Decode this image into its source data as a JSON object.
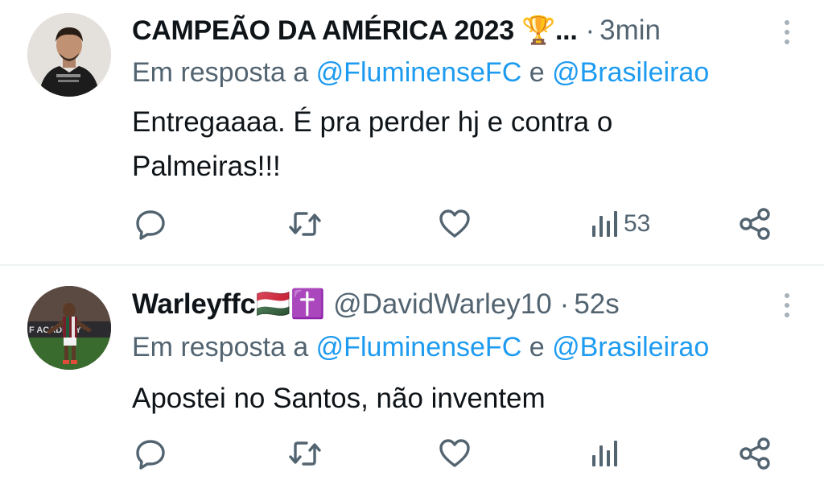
{
  "tweets": [
    {
      "display_name": "CAMPEÃO DA AMÉRICA 2023 🏆...",
      "handle": "",
      "separator": "·",
      "time": "3min",
      "reply_prefix": "Em resposta a",
      "mention_1": "@FluminenseFC",
      "reply_joiner": "e",
      "mention_2": "@Brasileirao",
      "text": "Entregaaaa. É pra perder hj e contra o Palmeiras!!!",
      "views": "53",
      "avatar_icon": "user-avatar-photo"
    },
    {
      "display_name": "Warleyffc🇭🇺✝️",
      "handle": "@DavidWarley10",
      "separator": "·",
      "time": "52s",
      "reply_prefix": "Em resposta a",
      "mention_1": "@FluminenseFC",
      "reply_joiner": "e",
      "mention_2": "@Brasileirao",
      "text": "Apostei no Santos, não inventem",
      "views": "",
      "avatar_icon": "user-avatar-photo"
    }
  ],
  "colors": {
    "text_primary": "#0f1419",
    "text_secondary": "#536471",
    "link": "#1d9bf0",
    "divider": "#eff3f4"
  },
  "icons": [
    "more-vertical-icon",
    "reply-icon",
    "retweet-icon",
    "like-icon",
    "views-icon",
    "share-icon"
  ]
}
